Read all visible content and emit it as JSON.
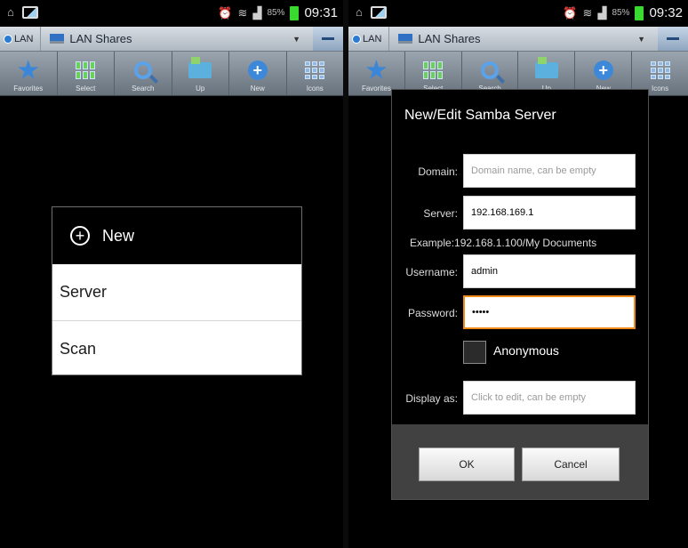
{
  "left_screen": {
    "statusbar": {
      "time": "09:31",
      "battery": "85%"
    },
    "titlebar": {
      "lan_label": "LAN",
      "share_label": "LAN Shares"
    },
    "toolbar": {
      "favorites": "Favorites",
      "select": "Select",
      "search": "Search",
      "up": "Up",
      "new": "New",
      "icons": "Icons"
    },
    "popup": {
      "title": "New",
      "items": [
        "Server",
        "Scan"
      ]
    }
  },
  "right_screen": {
    "statusbar": {
      "time": "09:32",
      "battery": "85%"
    },
    "titlebar": {
      "lan_label": "LAN",
      "share_label": "LAN Shares"
    },
    "toolbar": {
      "favorites": "Favorites",
      "select": "Select",
      "search": "Search",
      "up": "Up",
      "new": "New",
      "icons": "Icons"
    },
    "dialog": {
      "title": "New/Edit Samba Server",
      "domain_label": "Domain:",
      "domain_placeholder": "Domain name, can be empty",
      "server_label": "Server:",
      "server_value": "192.168.169.1",
      "example": "Example:192.168.1.100/My Documents",
      "username_label": "Username:",
      "username_value": "admin",
      "password_label": "Password:",
      "password_value": "•••••",
      "anonymous_label": "Anonymous",
      "display_label": "Display as:",
      "display_placeholder": "Click to edit, can be empty",
      "ok_label": "OK",
      "cancel_label": "Cancel"
    }
  },
  "colors": {
    "focus_border": "#f08a1a",
    "battery": "#3ad92f",
    "accent_blue": "#3a86d9"
  }
}
